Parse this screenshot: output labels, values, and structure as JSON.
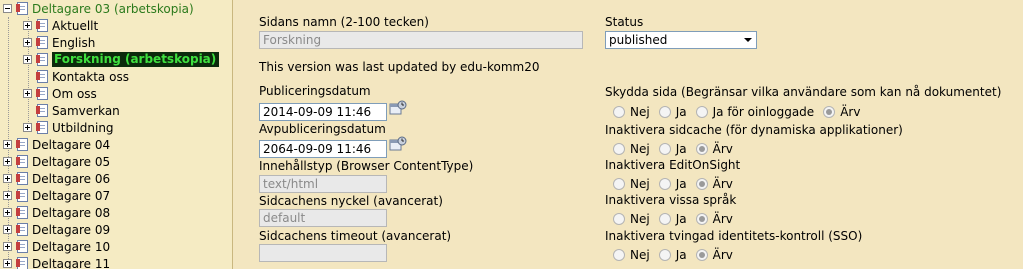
{
  "tree": {
    "items": [
      {
        "label": "Deltagare 03 (arbetskopia)",
        "style": "green"
      },
      {
        "label": "Aktuellt"
      },
      {
        "label": "English"
      },
      {
        "label": "Forskning (arbetskopia)",
        "style": "selected"
      },
      {
        "label": "Kontakta oss"
      },
      {
        "label": "Om oss"
      },
      {
        "label": "Samverkan"
      },
      {
        "label": "Utbildning"
      },
      {
        "label": "Deltagare 04"
      },
      {
        "label": "Deltagare 05"
      },
      {
        "label": "Deltagare 06"
      },
      {
        "label": "Deltagare 07"
      },
      {
        "label": "Deltagare 08"
      },
      {
        "label": "Deltagare 09"
      },
      {
        "label": "Deltagare 10"
      },
      {
        "label": "Deltagare 11"
      }
    ]
  },
  "form": {
    "page_name_label": "Sidans namn (2-100 tecken)",
    "page_name_value": "Forskning",
    "last_updated_text": "This version was last updated by edu-komm20",
    "publish_date_label": "Publiceringsdatum",
    "publish_date_value": "2014-09-09 11:46",
    "unpublish_date_label": "Avpubliceringsdatum",
    "unpublish_date_value": "2064-09-09 11:46",
    "content_type_label": "Innehållstyp (Browser ContentType)",
    "content_type_value": "text/html",
    "cache_key_label": "Sidcachens nyckel (avancerat)",
    "cache_key_value": "default",
    "cache_timeout_label": "Sidcachens timeout (avancerat)",
    "cache_timeout_value": "",
    "status_label": "Status",
    "status_value": "published",
    "protect_label": "Skydda sida (Begränsar vilka användare som kan nå dokumentet)",
    "protect_options": [
      "Nej",
      "Ja",
      "Ja för oinloggade",
      "Ärv"
    ],
    "disable_cache_label": "Inaktivera sidcache (för dynamiska applikationer)",
    "disable_editonsight_label": "Inaktivera EditOnSight",
    "disable_languages_label": "Inaktivera vissa språk",
    "disable_sso_label": "Inaktivera tvingad identitets-kontroll (SSO)",
    "yes_no_inherit": [
      "Nej",
      "Ja",
      "Ärv"
    ]
  },
  "colors": {
    "tree_background": "#f5ebc3",
    "form_background": "#f3e6c0",
    "selected_bg": "#0c2a0c",
    "selected_fg": "#3fe03f",
    "working_copy_green": "#2b7a1c"
  }
}
